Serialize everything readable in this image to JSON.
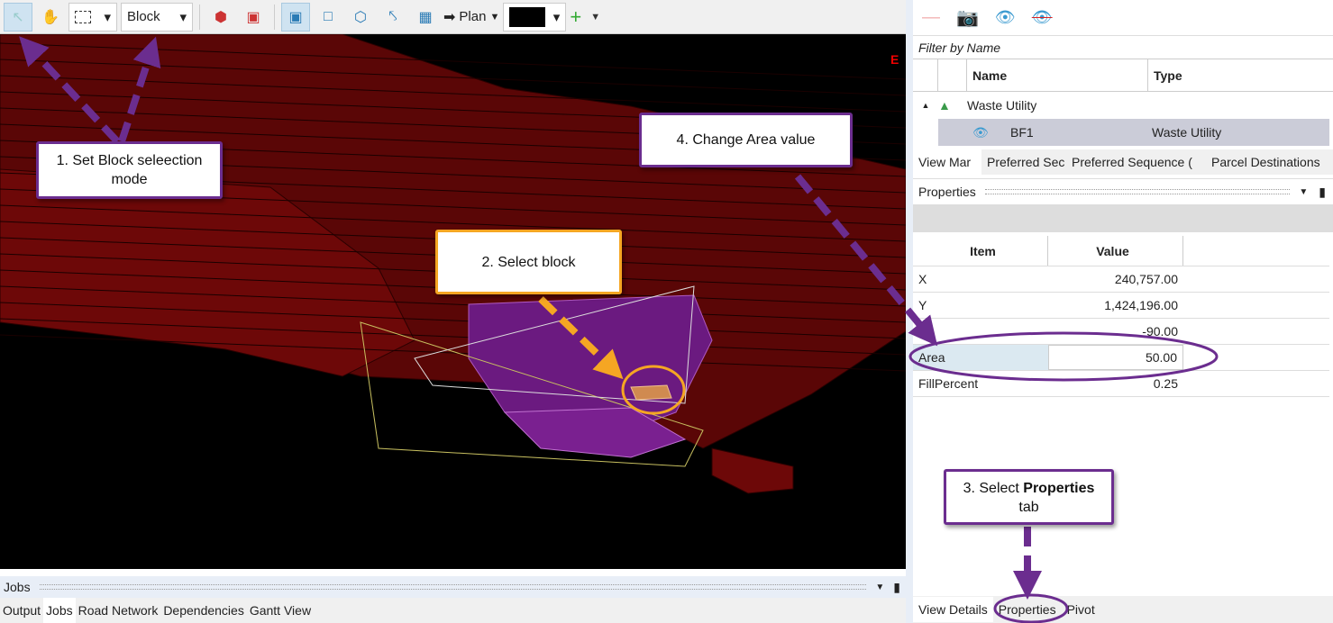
{
  "toolbar": {
    "mode": "Block",
    "view": "Plan",
    "icons": [
      "select-arrow-icon",
      "pan-hand-icon",
      "marquee-select-icon",
      "block-solid-icon",
      "block-point-icon",
      "wireframe-box-icon",
      "box-outline-icon",
      "rotate-box-icon",
      "axes-icon",
      "grid-icon",
      "plan-arrow-icon",
      "add-icon"
    ],
    "color": "#000000"
  },
  "viewport": {
    "axis_label": "E"
  },
  "jobs_panel": {
    "title": "Jobs",
    "tabs": [
      "Output",
      "Jobs",
      "Road Network",
      "Dependencies",
      "Gantt View"
    ],
    "selected": "Jobs"
  },
  "right_panel": {
    "filter_placeholder": "Filter by Name",
    "columns": [
      "Name",
      "Type"
    ],
    "tree": {
      "group": "Waste Utility",
      "child": {
        "name": "BF1",
        "type": "Waste Utility"
      }
    },
    "tabs": [
      "View Mar",
      "Preferred Sec",
      "Preferred Sequence (",
      "Parcel Destinations"
    ],
    "properties_title": "Properties",
    "prop_columns": [
      "Item",
      "Value"
    ],
    "props": [
      {
        "k": "X",
        "v": "240,757.00"
      },
      {
        "k": "Y",
        "v": "1,424,196.00"
      },
      {
        "k": "",
        "v": "-90.00"
      },
      {
        "k": "Area",
        "v": "50.00"
      },
      {
        "k": "FillPercent",
        "v": "0.25"
      }
    ],
    "bottom_tabs": [
      "View Details",
      "Properties",
      "Pivot"
    ]
  },
  "callouts": {
    "c1": "1. Set Block seleection mode",
    "c2": "2. Select block",
    "c3a": "3. Select ",
    "c3b": "Properties",
    "c3c": " tab",
    "c4": "4. Change Area value"
  },
  "colors": {
    "accent": "#6b2d8f",
    "highlight": "#f5a623",
    "block": "#7a0a0a"
  }
}
